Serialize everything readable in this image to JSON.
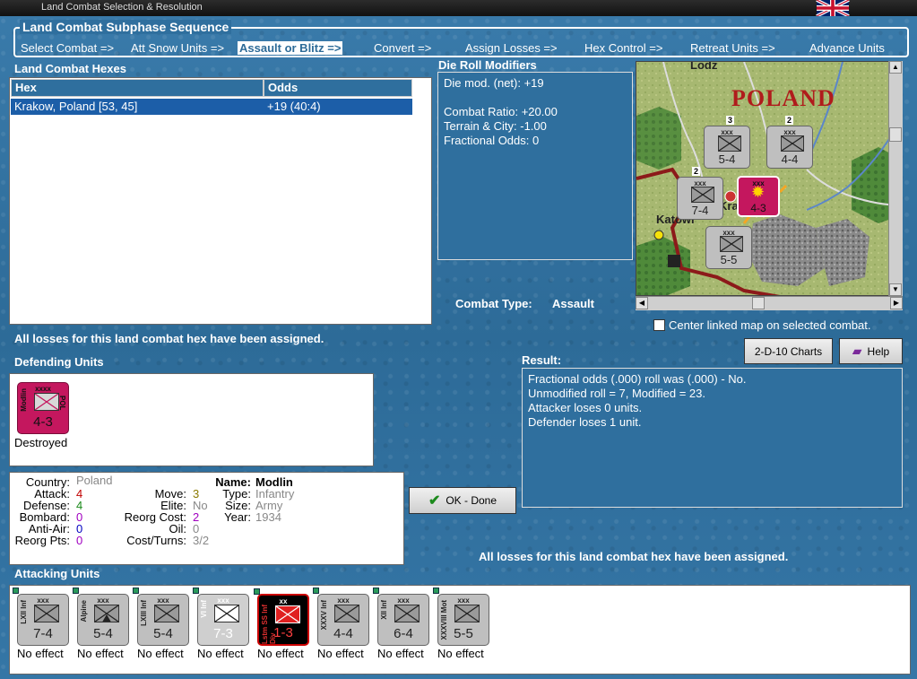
{
  "window": {
    "title": "Land Combat Selection & Resolution"
  },
  "subphase": {
    "title": "Land Combat Subphase Sequence",
    "items": [
      {
        "label": "Select Combat =>",
        "active": false
      },
      {
        "label": "Att Snow Units =>",
        "active": false
      },
      {
        "label": "Assault or Blitz =>",
        "active": true
      },
      {
        "label": "Convert =>",
        "active": false
      },
      {
        "label": "Assign Losses =>",
        "active": false
      },
      {
        "label": "Hex Control =>",
        "active": false
      },
      {
        "label": "Retreat Units =>",
        "active": false
      },
      {
        "label": "Advance Units",
        "active": false
      }
    ]
  },
  "hexes": {
    "title": "Land Combat Hexes",
    "columns": [
      "Hex",
      "Odds"
    ],
    "rows": [
      {
        "hex": "Krakow, Poland [53, 45]",
        "odds": "+19 (40:4)"
      }
    ]
  },
  "modifiers": {
    "title": "Die Roll Modifiers",
    "net": "Die mod. (net): +19",
    "combat_ratio": "Combat Ratio: +20.00",
    "terrain": "Terrain & City: -1.00",
    "fractional": "Fractional Odds: 0"
  },
  "combat_type": {
    "label": "Combat Type:",
    "value": "Assault"
  },
  "map": {
    "country_label": "POLAND",
    "city_top": "Lodz",
    "city_left": "Katowi",
    "city_center": "Kra",
    "center_checkbox_label": "Center linked map on selected combat."
  },
  "buttons": {
    "charts": "2-D-10 Charts",
    "help": "Help",
    "ok": "OK - Done"
  },
  "status_msg": "All losses for this land combat hex have been assigned.",
  "status_msg2": "All losses for this land combat hex have been assigned.",
  "defenders": {
    "title": "Defending Units",
    "units": [
      {
        "corps": "Modlin",
        "size": "xxxx",
        "nation": "POL",
        "strength": "4-3",
        "effect": "Destroyed"
      }
    ]
  },
  "details": {
    "country_label": "Country:",
    "country": "Poland",
    "attack_label": "Attack:",
    "attack": "4",
    "defense_label": "Defense:",
    "defense": "4",
    "bombard_label": "Bombard:",
    "bombard": "0",
    "antiair_label": "Anti-Air:",
    "antiair": "0",
    "reorgpts_label": "Reorg Pts:",
    "reorgpts": "0",
    "move_label": "Move:",
    "move": "3",
    "elite_label": "Elite:",
    "elite": "No",
    "reorgcost_label": "Reorg Cost:",
    "reorgcost": "2",
    "oil_label": "Oil:",
    "oil": "0",
    "costturns_label": "Cost/Turns:",
    "costturns": "3/2",
    "name_label": "Name:",
    "name": "Modlin",
    "type_label": "Type:",
    "type": "Infantry",
    "size_label": "Size:",
    "size": "Army",
    "year_label": "Year:",
    "year": "1934"
  },
  "result": {
    "title": "Result:",
    "lines": [
      "Fractional odds (.000) roll was (.000)  - No.",
      "Unmodified roll = 7, Modified = 23.",
      "Attacker loses 0 units.",
      "Defender loses 1 unit."
    ]
  },
  "attackers": {
    "title": "Attacking Units",
    "units": [
      {
        "corps": "LXII Inf",
        "size": "xxx",
        "strength": "7-4",
        "effect": "No effect"
      },
      {
        "corps": "Alpine",
        "size": "xxx",
        "strength": "5-4",
        "effect": "No effect"
      },
      {
        "corps": "LXIII Inf",
        "size": "xxx",
        "strength": "5-4",
        "effect": "No effect"
      },
      {
        "corps": "VI Inf",
        "size": "xxx",
        "strength": "7-3",
        "effect": "No effect"
      },
      {
        "corps": "Lstm SS Inf Div",
        "size": "xx",
        "strength": "1-3",
        "effect": "No effect"
      },
      {
        "corps": "XXXV Inf",
        "size": "xxx",
        "strength": "4-4",
        "effect": "No effect"
      },
      {
        "corps": "XII Inf",
        "size": "xxx",
        "strength": "6-4",
        "effect": "No effect"
      },
      {
        "corps": "XXXVIII Mot",
        "size": "xxx",
        "strength": "5-5",
        "effect": "No effect"
      }
    ]
  },
  "map_units": [
    {
      "size": "xxx",
      "strength": "5-4",
      "stack": "3"
    },
    {
      "size": "xxx",
      "strength": "4-4",
      "stack": "2"
    },
    {
      "size": "xxx",
      "strength": "7-4",
      "stack": "2"
    },
    {
      "size": "xxx",
      "strength": "4-3",
      "stack": ""
    },
    {
      "size": "xxx",
      "strength": "5-5",
      "stack": ""
    }
  ]
}
